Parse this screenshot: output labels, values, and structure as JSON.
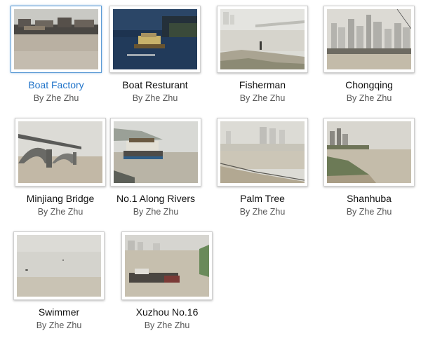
{
  "gallery": {
    "items": [
      {
        "title": "Boat Factory",
        "author": "By Zhe Zhu",
        "thumbnail": "boat-factory-photo",
        "selected": true
      },
      {
        "title": "Boat Resturant",
        "author": "By Zhe Zhu",
        "thumbnail": "boat-restaurant-photo",
        "selected": false
      },
      {
        "title": "Fisherman",
        "author": "By Zhe Zhu",
        "thumbnail": "fisherman-photo",
        "selected": false
      },
      {
        "title": "Chongqing",
        "author": "By Zhe Zhu",
        "thumbnail": "chongqing-photo",
        "selected": false
      },
      {
        "title": "Minjiang Bridge",
        "author": "By Zhe Zhu",
        "thumbnail": "minjiang-bridge-photo",
        "selected": false
      },
      {
        "title": "No.1 Along Rivers",
        "author": "By Zhe Zhu",
        "thumbnail": "no1-along-rivers-photo",
        "selected": false
      },
      {
        "title": "Palm Tree",
        "author": "By Zhe Zhu",
        "thumbnail": "palm-tree-photo",
        "selected": false
      },
      {
        "title": "Shanhuba",
        "author": "By Zhe Zhu",
        "thumbnail": "shanhuba-photo",
        "selected": false
      },
      {
        "title": "Swimmer",
        "author": "By Zhe Zhu",
        "thumbnail": "swimmer-photo",
        "selected": false
      },
      {
        "title": "Xuzhou No.16",
        "author": "By Zhe Zhu",
        "thumbnail": "xuzhou-no16-photo",
        "selected": false
      }
    ]
  },
  "colors": {
    "link_active": "#1f73c9",
    "title_text": "#111111",
    "byline_text": "#555555",
    "frame_border": "#cfcfcf",
    "selected_border": "#5b9bd5"
  }
}
